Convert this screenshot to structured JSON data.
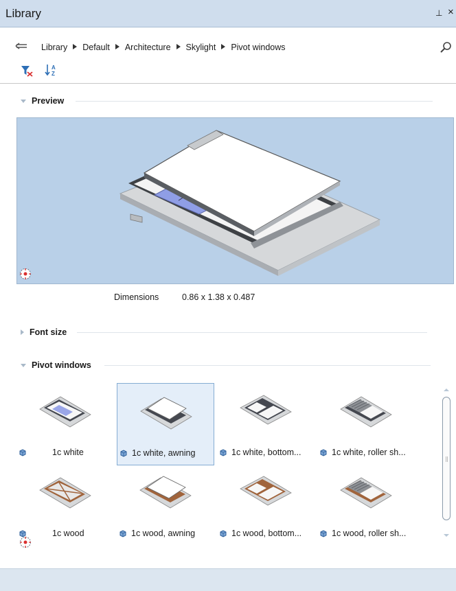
{
  "window": {
    "title": "Library",
    "pin_glyph": "⊥",
    "close_glyph": "×"
  },
  "breadcrumb": [
    "Library",
    "Default",
    "Architecture",
    "Skylight",
    "Pivot windows"
  ],
  "icons": {
    "back": "arrow-left-icon",
    "search": "search-icon",
    "filter": "filter-icon",
    "sort": "sort-az-icon",
    "navigate": "compass-icon"
  },
  "sections": {
    "preview": {
      "label": "Preview",
      "expanded": true
    },
    "font_size": {
      "label": "Font size",
      "expanded": false
    },
    "pivot_windows": {
      "label": "Pivot windows",
      "expanded": true
    }
  },
  "dimensions": {
    "label": "Dimensions",
    "value": "0.86 x 1.38 x 0.487"
  },
  "items": [
    {
      "label": "1c white",
      "material": "white",
      "variant": "plain",
      "selected": false
    },
    {
      "label": "1c white, awning",
      "material": "white",
      "variant": "awning",
      "selected": true
    },
    {
      "label": "1c white, bottom...",
      "material": "white",
      "variant": "bottom",
      "selected": false
    },
    {
      "label": "1c white, roller sh...",
      "material": "white",
      "variant": "roller",
      "selected": false
    },
    {
      "label": "1c wood",
      "material": "wood",
      "variant": "plain",
      "selected": false
    },
    {
      "label": "1c wood, awning",
      "material": "wood",
      "variant": "awning",
      "selected": false
    },
    {
      "label": "1c wood, bottom...",
      "material": "wood",
      "variant": "bottom",
      "selected": false
    },
    {
      "label": "1c wood, roller sh...",
      "material": "wood",
      "variant": "roller",
      "selected": false
    }
  ],
  "colors": {
    "titlebar": "#cfdded",
    "preview_bg": "#b9d0e8",
    "selection": "#e4eef9",
    "selection_border": "#84acd3",
    "wood": "#a0643c"
  }
}
